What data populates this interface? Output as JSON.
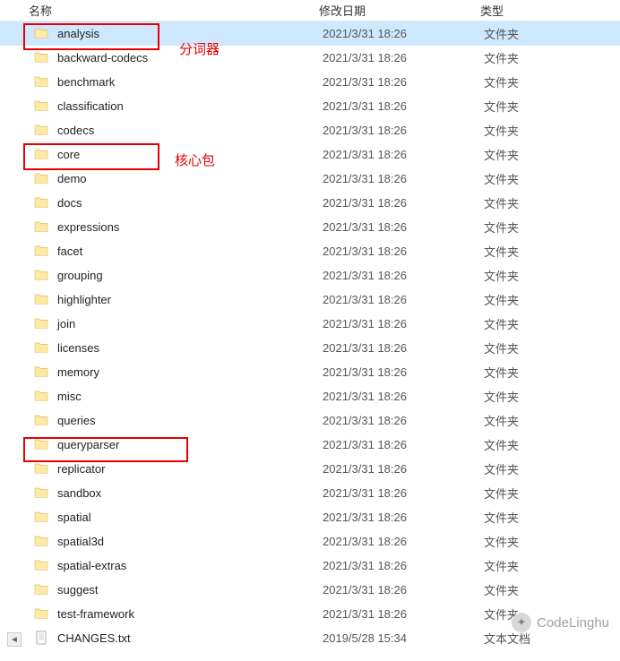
{
  "header": {
    "name": "名称",
    "date": "修改日期",
    "type": "类型"
  },
  "annotations": {
    "analysis_label": "分词器",
    "core_label": "核心包"
  },
  "watermark": "CodeLinghu",
  "rows": [
    {
      "name": "analysis",
      "date": "2021/3/31 18:26",
      "type": "文件夹",
      "kind": "folder",
      "selected": true
    },
    {
      "name": "backward-codecs",
      "date": "2021/3/31 18:26",
      "type": "文件夹",
      "kind": "folder"
    },
    {
      "name": "benchmark",
      "date": "2021/3/31 18:26",
      "type": "文件夹",
      "kind": "folder"
    },
    {
      "name": "classification",
      "date": "2021/3/31 18:26",
      "type": "文件夹",
      "kind": "folder"
    },
    {
      "name": "codecs",
      "date": "2021/3/31 18:26",
      "type": "文件夹",
      "kind": "folder"
    },
    {
      "name": "core",
      "date": "2021/3/31 18:26",
      "type": "文件夹",
      "kind": "folder"
    },
    {
      "name": "demo",
      "date": "2021/3/31 18:26",
      "type": "文件夹",
      "kind": "folder"
    },
    {
      "name": "docs",
      "date": "2021/3/31 18:26",
      "type": "文件夹",
      "kind": "folder"
    },
    {
      "name": "expressions",
      "date": "2021/3/31 18:26",
      "type": "文件夹",
      "kind": "folder"
    },
    {
      "name": "facet",
      "date": "2021/3/31 18:26",
      "type": "文件夹",
      "kind": "folder"
    },
    {
      "name": "grouping",
      "date": "2021/3/31 18:26",
      "type": "文件夹",
      "kind": "folder"
    },
    {
      "name": "highlighter",
      "date": "2021/3/31 18:26",
      "type": "文件夹",
      "kind": "folder"
    },
    {
      "name": "join",
      "date": "2021/3/31 18:26",
      "type": "文件夹",
      "kind": "folder"
    },
    {
      "name": "licenses",
      "date": "2021/3/31 18:26",
      "type": "文件夹",
      "kind": "folder"
    },
    {
      "name": "memory",
      "date": "2021/3/31 18:26",
      "type": "文件夹",
      "kind": "folder"
    },
    {
      "name": "misc",
      "date": "2021/3/31 18:26",
      "type": "文件夹",
      "kind": "folder"
    },
    {
      "name": "queries",
      "date": "2021/3/31 18:26",
      "type": "文件夹",
      "kind": "folder"
    },
    {
      "name": "queryparser",
      "date": "2021/3/31 18:26",
      "type": "文件夹",
      "kind": "folder"
    },
    {
      "name": "replicator",
      "date": "2021/3/31 18:26",
      "type": "文件夹",
      "kind": "folder"
    },
    {
      "name": "sandbox",
      "date": "2021/3/31 18:26",
      "type": "文件夹",
      "kind": "folder"
    },
    {
      "name": "spatial",
      "date": "2021/3/31 18:26",
      "type": "文件夹",
      "kind": "folder"
    },
    {
      "name": "spatial3d",
      "date": "2021/3/31 18:26",
      "type": "文件夹",
      "kind": "folder"
    },
    {
      "name": "spatial-extras",
      "date": "2021/3/31 18:26",
      "type": "文件夹",
      "kind": "folder"
    },
    {
      "name": "suggest",
      "date": "2021/3/31 18:26",
      "type": "文件夹",
      "kind": "folder"
    },
    {
      "name": "test-framework",
      "date": "2021/3/31 18:26",
      "type": "文件夹",
      "kind": "folder"
    },
    {
      "name": "CHANGES.txt",
      "date": "2019/5/28 15:34",
      "type": "文本文档",
      "kind": "file"
    }
  ]
}
